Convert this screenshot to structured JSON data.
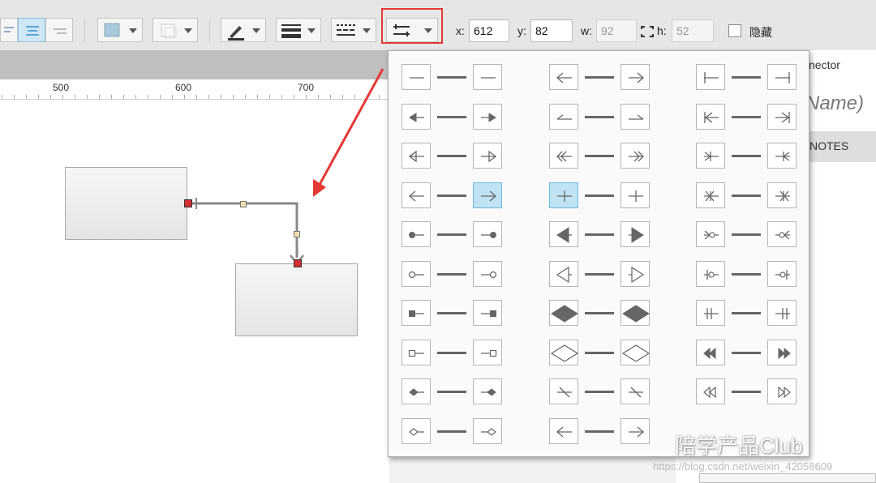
{
  "toolbar": {
    "x_label": "x:",
    "x_value": "612",
    "y_label": "y:",
    "y_value": "82",
    "w_label": "w:",
    "w_value": "92",
    "h_label": "h:",
    "h_value": "52",
    "hidden_label": "隐藏"
  },
  "ruler": {
    "labels": [
      "500",
      "600",
      "700"
    ]
  },
  "right_panel": {
    "title": "nector",
    "name_placeholder": "Name)",
    "notes_label": "NOTES"
  },
  "watermark": {
    "brand": "陪学产品Club",
    "url": "https://blog.csdn.net/weixin_42058609"
  },
  "colors": {
    "selected": "#bfe3f3",
    "highlight": "#e53935",
    "handle": "#d32f2f"
  },
  "arrow_styles": {
    "columns": [
      [
        "none",
        "filled-arrow",
        "open-arrow",
        "open-arrow-small",
        "dot",
        "circle",
        "square",
        "open-square",
        "diamond",
        "open-diamond"
      ],
      [
        "arrow-thin",
        "half-arrow",
        "double-chevron",
        "plus",
        "filled-triangle",
        "open-triangle",
        "filled-diamond",
        "open-diamond-large",
        "slash",
        "arrow-thin-2"
      ],
      [
        "bar",
        "bar-arrow",
        "crows-one",
        "crows-star",
        "crows-circle",
        "circle-bar",
        "double-bar",
        "double-filled-triangle",
        "double-open-triangle",
        ""
      ]
    ],
    "selected": [
      {
        "col": 0,
        "row": 3,
        "side": "right"
      },
      {
        "col": 1,
        "row": 3,
        "side": "left"
      }
    ]
  }
}
